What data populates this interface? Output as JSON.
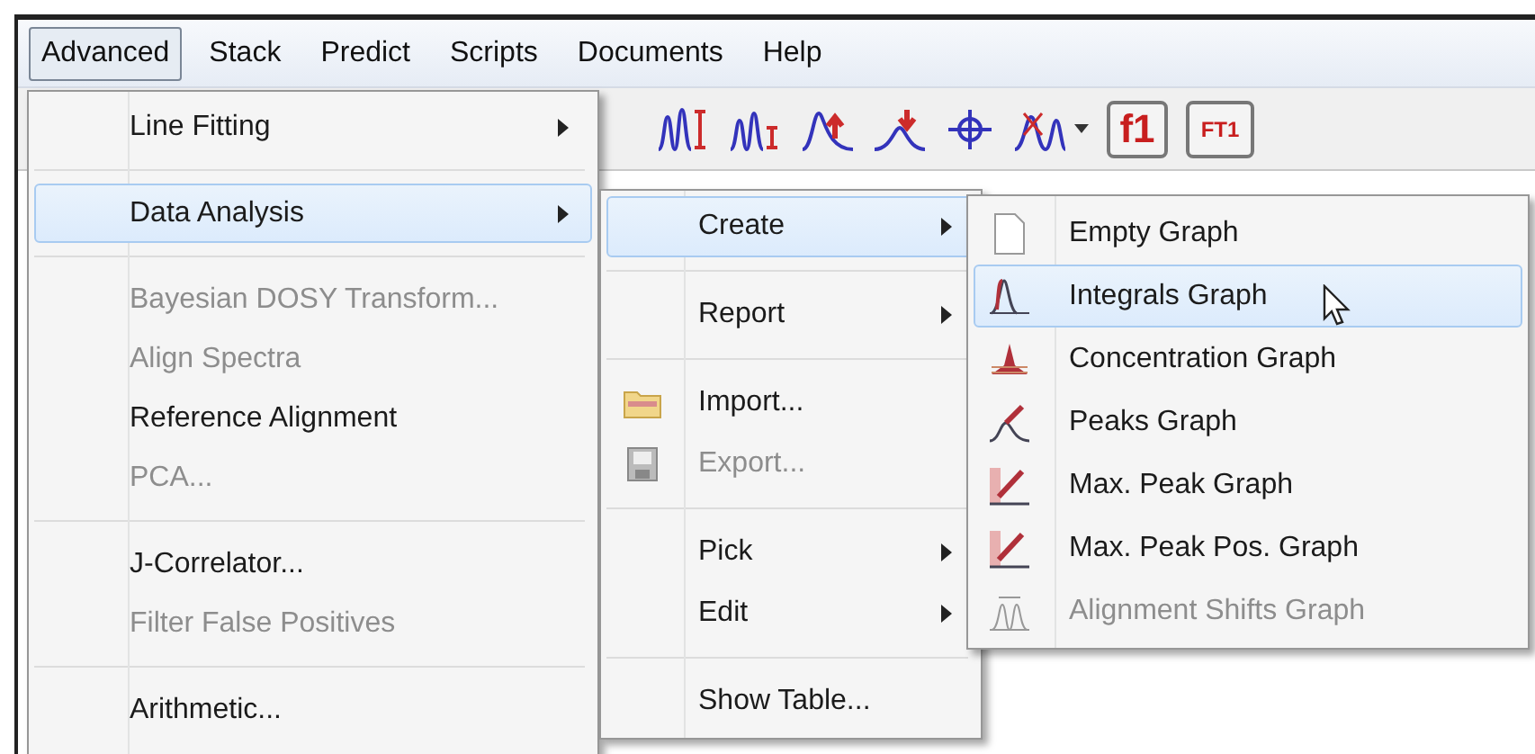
{
  "menubar": [
    {
      "label": "Advanced",
      "selected": true
    },
    {
      "label": "Stack",
      "selected": false
    },
    {
      "label": "Predict",
      "selected": false
    },
    {
      "label": "Scripts",
      "selected": false
    },
    {
      "label": "Documents",
      "selected": false
    },
    {
      "label": "Help",
      "selected": false
    }
  ],
  "toolbar": [
    {
      "kind": "icon"
    },
    {
      "kind": "icon"
    },
    {
      "kind": "icon"
    },
    {
      "kind": "icon"
    },
    {
      "kind": "icon"
    },
    {
      "kind": "icon"
    },
    {
      "kind": "text",
      "label": "f1"
    },
    {
      "kind": "text",
      "label": "FT1"
    }
  ],
  "menu": [
    {
      "kind": "item",
      "label": "Line Fitting",
      "submenu": true,
      "disabled": false,
      "selected": false
    },
    {
      "kind": "separator"
    },
    {
      "kind": "item",
      "label": "Data Analysis",
      "submenu": true,
      "disabled": false,
      "selected": true
    },
    {
      "kind": "separator"
    },
    {
      "kind": "item",
      "label": "Bayesian DOSY Transform...",
      "submenu": false,
      "disabled": true,
      "selected": false
    },
    {
      "kind": "item",
      "label": "Align Spectra",
      "submenu": false,
      "disabled": true,
      "selected": false
    },
    {
      "kind": "item",
      "label": "Reference Alignment",
      "submenu": false,
      "disabled": false,
      "selected": false
    },
    {
      "kind": "item",
      "label": "PCA...",
      "submenu": false,
      "disabled": true,
      "selected": false
    },
    {
      "kind": "separator"
    },
    {
      "kind": "item",
      "label": "J-Correlator...",
      "submenu": false,
      "disabled": false,
      "selected": false
    },
    {
      "kind": "item",
      "label": "Filter False Positives",
      "submenu": false,
      "disabled": true,
      "selected": false
    },
    {
      "kind": "separator"
    },
    {
      "kind": "item",
      "label": "Arithmetic...",
      "submenu": false,
      "disabled": false,
      "selected": false
    }
  ],
  "submenu": [
    {
      "kind": "item",
      "label": "Create",
      "submenu": true,
      "disabled": false,
      "selected": true
    },
    {
      "kind": "separator"
    },
    {
      "kind": "item",
      "label": "Report",
      "submenu": true,
      "disabled": false,
      "selected": false
    },
    {
      "kind": "separator"
    },
    {
      "kind": "item",
      "label": "Import...",
      "submenu": false,
      "disabled": false,
      "selected": false
    },
    {
      "kind": "item",
      "label": "Export...",
      "submenu": false,
      "disabled": true,
      "selected": false
    },
    {
      "kind": "separator"
    },
    {
      "kind": "item",
      "label": "Pick",
      "submenu": true,
      "disabled": false,
      "selected": false
    },
    {
      "kind": "item",
      "label": "Edit",
      "submenu": true,
      "disabled": false,
      "selected": false
    },
    {
      "kind": "separator"
    },
    {
      "kind": "item",
      "label": "Show Table...",
      "submenu": false,
      "disabled": false,
      "selected": false
    }
  ],
  "create_menu": [
    {
      "kind": "item",
      "label": "Empty Graph",
      "submenu": false,
      "disabled": false,
      "selected": false
    },
    {
      "kind": "item",
      "label": "Integrals Graph",
      "submenu": false,
      "disabled": false,
      "selected": true
    },
    {
      "kind": "item",
      "label": "Concentration Graph",
      "submenu": false,
      "disabled": false,
      "selected": false
    },
    {
      "kind": "item",
      "label": "Peaks Graph",
      "submenu": false,
      "disabled": false,
      "selected": false
    },
    {
      "kind": "item",
      "label": "Max. Peak Graph",
      "submenu": false,
      "disabled": false,
      "selected": false
    },
    {
      "kind": "item",
      "label": "Max. Peak Pos. Graph",
      "submenu": false,
      "disabled": false,
      "selected": false
    },
    {
      "kind": "item",
      "label": "Alignment Shifts Graph",
      "submenu": false,
      "disabled": true,
      "selected": false
    }
  ]
}
